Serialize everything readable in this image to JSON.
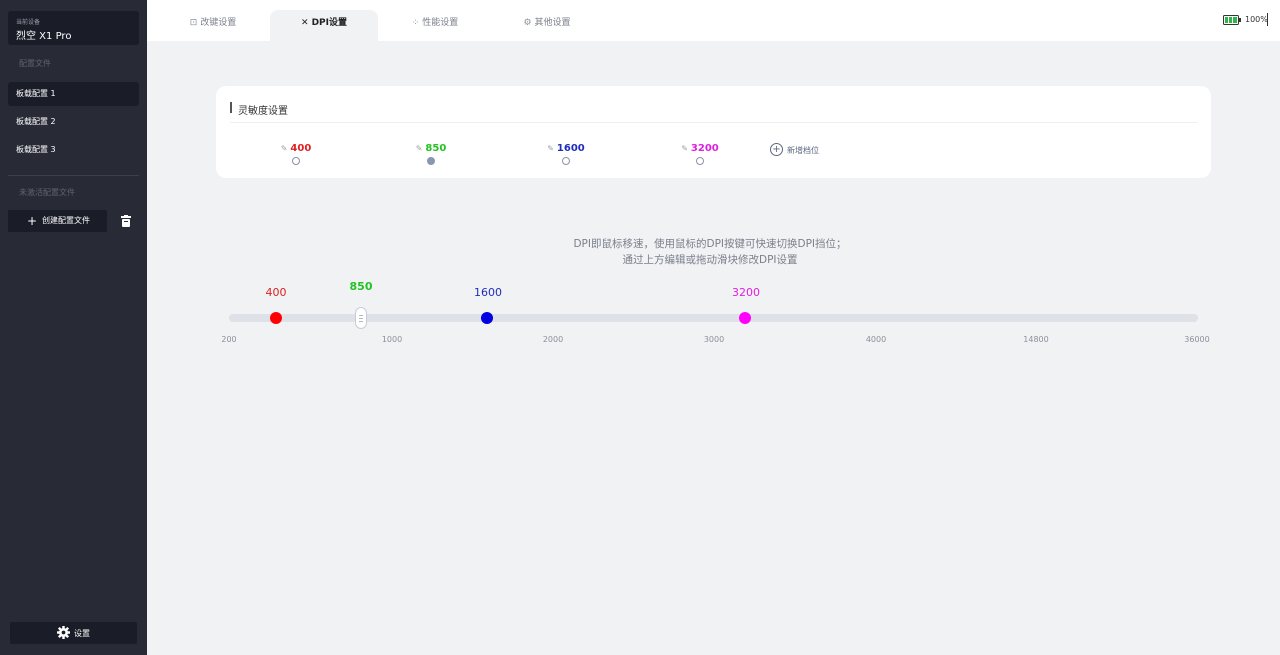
{
  "sidebar": {
    "device_caption": "当前设备",
    "device_name": "烈空 X1 Pro",
    "profiles_label": "配置文件",
    "profiles": [
      {
        "label": "板载配置 1",
        "active": true
      },
      {
        "label": "板载配置 2",
        "active": false
      },
      {
        "label": "板载配置 3",
        "active": false
      }
    ],
    "inactive_label": "未激活配置文件",
    "create_label": "创建配置文件",
    "settings_label": "设置"
  },
  "tabs": [
    {
      "label": "改键设置",
      "icon": "keymap-icon",
      "glyph": "⊡",
      "active": false
    },
    {
      "label": "DPI设置",
      "icon": "dpi-cross-icon",
      "glyph": "✕",
      "active": true
    },
    {
      "label": "性能设置",
      "icon": "performance-icon",
      "glyph": "⁘",
      "active": false
    },
    {
      "label": "其他设置",
      "icon": "gear-icon",
      "glyph": "⚙",
      "active": false
    }
  ],
  "battery": {
    "percent_label": "100%",
    "level": 1.0,
    "color": "#2fb54a"
  },
  "sensitivity": {
    "title": "灵敏度设置",
    "levels": [
      {
        "value": "400",
        "color": "#e02020",
        "selected": false
      },
      {
        "value": "850",
        "color": "#22c322",
        "selected": true
      },
      {
        "value": "1600",
        "color": "#1f2dbf",
        "selected": false
      },
      {
        "value": "3200",
        "color": "#e020e0",
        "selected": false
      }
    ],
    "add_label": "新增档位"
  },
  "hint": {
    "line1": "DPI即鼠标移速，使用鼠标的DPI按键可快速切换DPI挡位；",
    "line2": "通过上方编辑或拖动滑块修改DPI设置"
  },
  "slider": {
    "stops": [
      {
        "value": "400",
        "color": "#ff0000",
        "label_color": "#e02020"
      },
      {
        "value": "850",
        "color": "#ffffff",
        "label_color": "#22c322",
        "is_thumb": true
      },
      {
        "value": "1600",
        "color": "#0000e0",
        "label_color": "#1f2dbf"
      },
      {
        "value": "3200",
        "color": "#ff00ff",
        "label_color": "#e020e0"
      }
    ],
    "ticks": [
      "200",
      "1000",
      "2000",
      "3000",
      "4000",
      "14800",
      "36000"
    ]
  }
}
